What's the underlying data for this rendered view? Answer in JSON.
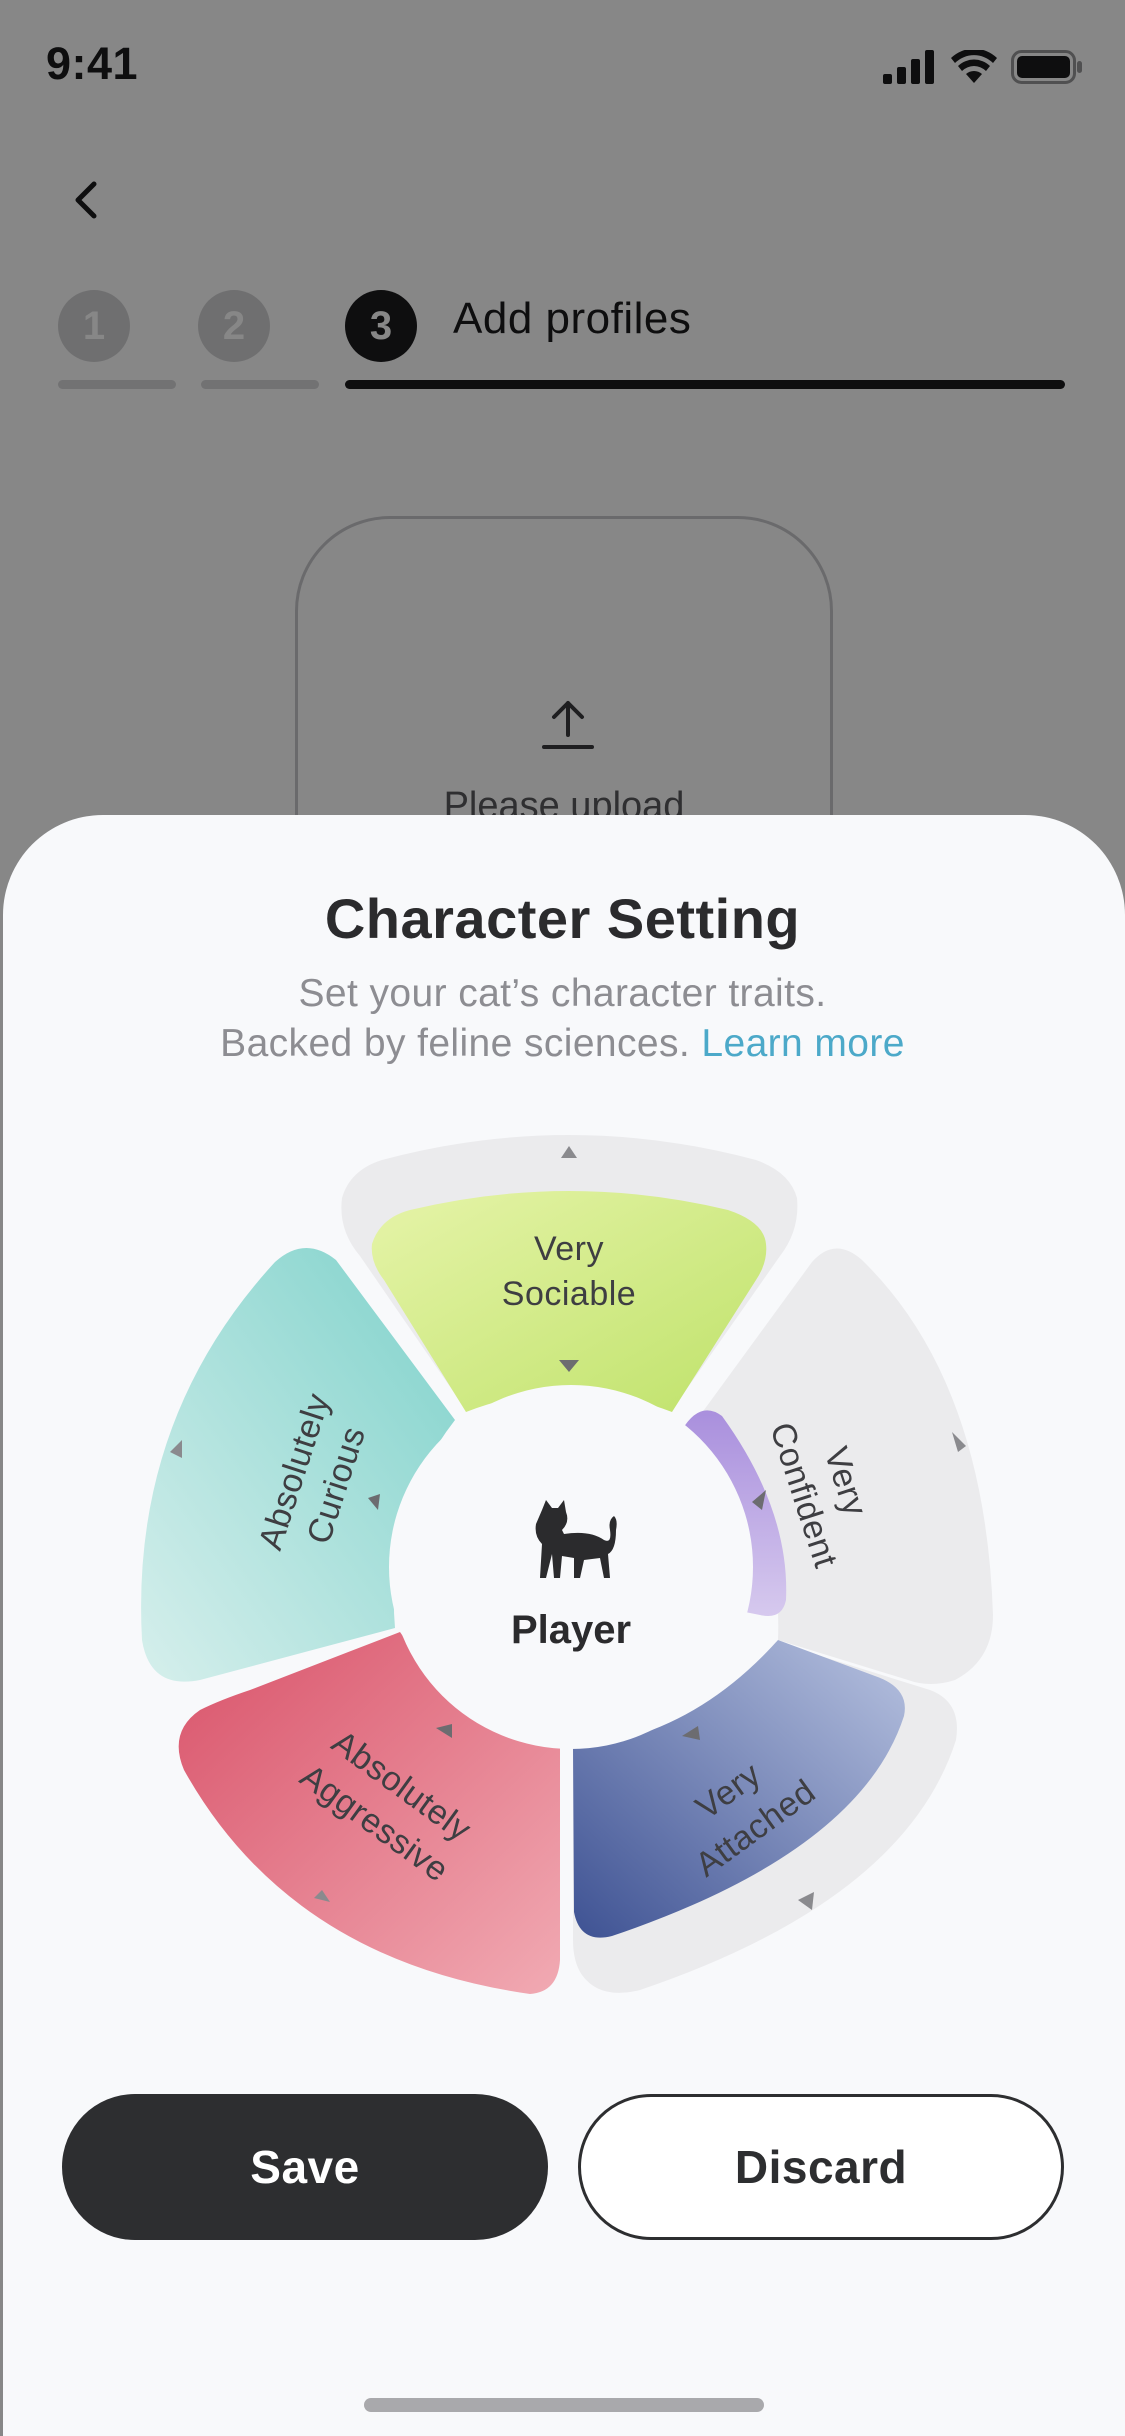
{
  "status_bar": {
    "time": "9:41"
  },
  "stepper": {
    "steps": [
      {
        "number": "1",
        "state": "done"
      },
      {
        "number": "2",
        "state": "done"
      },
      {
        "number": "3",
        "state": "active"
      }
    ],
    "active_title": "Add profiles"
  },
  "upload": {
    "text": "Please upload"
  },
  "sheet": {
    "title": "Character Setting",
    "subtitle_line1": "Set your cat’s character traits.",
    "subtitle_line2": "Backed by feline sciences.",
    "learn_more": "Learn more"
  },
  "wheel": {
    "center_label": "Player",
    "traits": [
      {
        "line1": "Very",
        "line2": "Sociable",
        "color": "#c9e57c"
      },
      {
        "line1": "Very",
        "line2": "Confident",
        "color": "#b09ae0"
      },
      {
        "line1": "Very",
        "line2": "Attached",
        "color": "#5066a3"
      },
      {
        "line1": "Absolutely",
        "line2": "Aggressive",
        "color": "#dc5f72"
      },
      {
        "line1": "Absolutely",
        "line2": "Curious",
        "color": "#8fd5cf"
      }
    ]
  },
  "actions": {
    "save_label": "Save",
    "discard_label": "Discard"
  }
}
